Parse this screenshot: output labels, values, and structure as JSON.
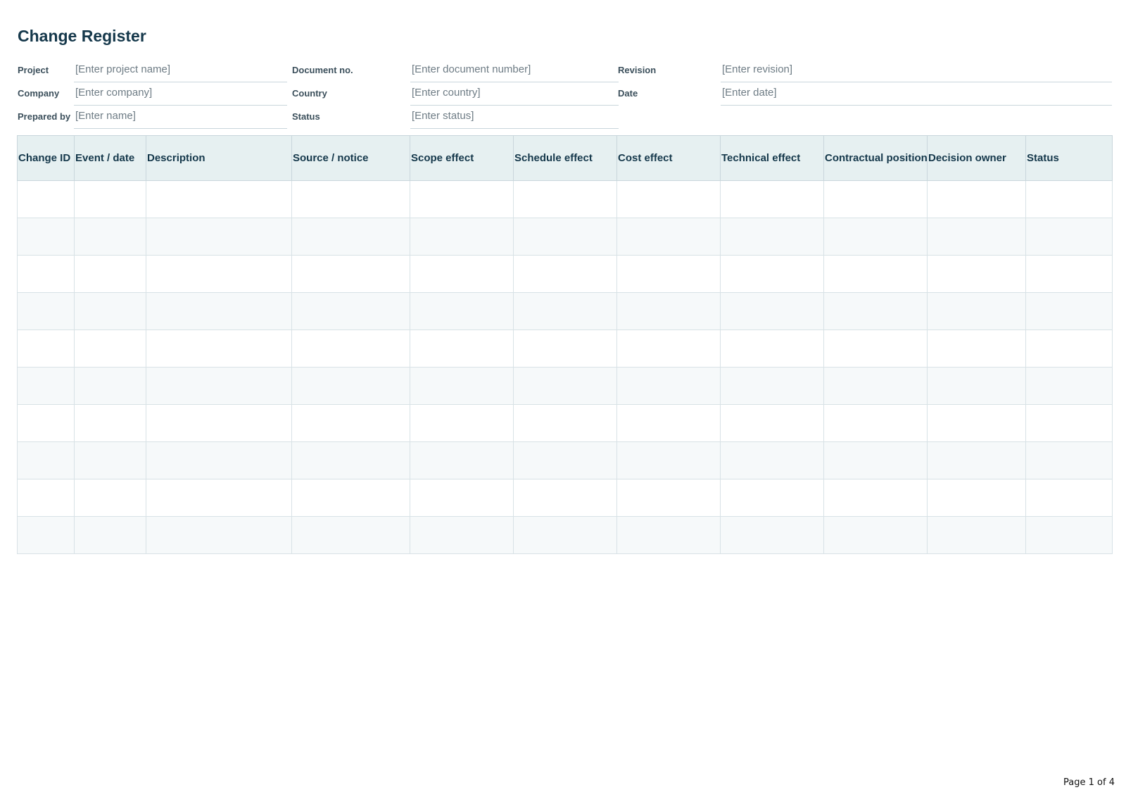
{
  "document": {
    "title": "Change Register"
  },
  "meta": {
    "project": {
      "label": "Project",
      "value": "[Enter project name]"
    },
    "document_no": {
      "label": "Document no.",
      "value": "[Enter document number]"
    },
    "revision": {
      "label": "Revision",
      "value": "[Enter revision]"
    },
    "company": {
      "label": "Company",
      "value": "[Enter company]"
    },
    "country": {
      "label": "Country",
      "value": "[Enter country]"
    },
    "date": {
      "label": "Date",
      "value": "[Enter date]"
    },
    "prepared_by": {
      "label": "Prepared by",
      "value": "[Enter name]"
    },
    "status": {
      "label": "Status",
      "value": "[Enter status]"
    }
  },
  "table": {
    "columns": [
      "Change ID",
      "Event / date",
      "Description",
      "Source / notice",
      "Scope effect",
      "Schedule effect",
      "Cost effect",
      "Technical effect",
      "Contractual position",
      "Decision owner",
      "Status"
    ],
    "rows": [
      [
        "",
        "",
        "",
        "",
        "",
        "",
        "",
        "",
        "",
        "",
        ""
      ],
      [
        "",
        "",
        "",
        "",
        "",
        "",
        "",
        "",
        "",
        "",
        ""
      ],
      [
        "",
        "",
        "",
        "",
        "",
        "",
        "",
        "",
        "",
        "",
        ""
      ],
      [
        "",
        "",
        "",
        "",
        "",
        "",
        "",
        "",
        "",
        "",
        ""
      ],
      [
        "",
        "",
        "",
        "",
        "",
        "",
        "",
        "",
        "",
        "",
        ""
      ],
      [
        "",
        "",
        "",
        "",
        "",
        "",
        "",
        "",
        "",
        "",
        ""
      ],
      [
        "",
        "",
        "",
        "",
        "",
        "",
        "",
        "",
        "",
        "",
        ""
      ],
      [
        "",
        "",
        "",
        "",
        "",
        "",
        "",
        "",
        "",
        "",
        ""
      ],
      [
        "",
        "",
        "",
        "",
        "",
        "",
        "",
        "",
        "",
        "",
        ""
      ],
      [
        "",
        "",
        "",
        "",
        "",
        "",
        "",
        "",
        "",
        "",
        ""
      ]
    ]
  },
  "footer": {
    "page": "Page 1 of 4"
  }
}
